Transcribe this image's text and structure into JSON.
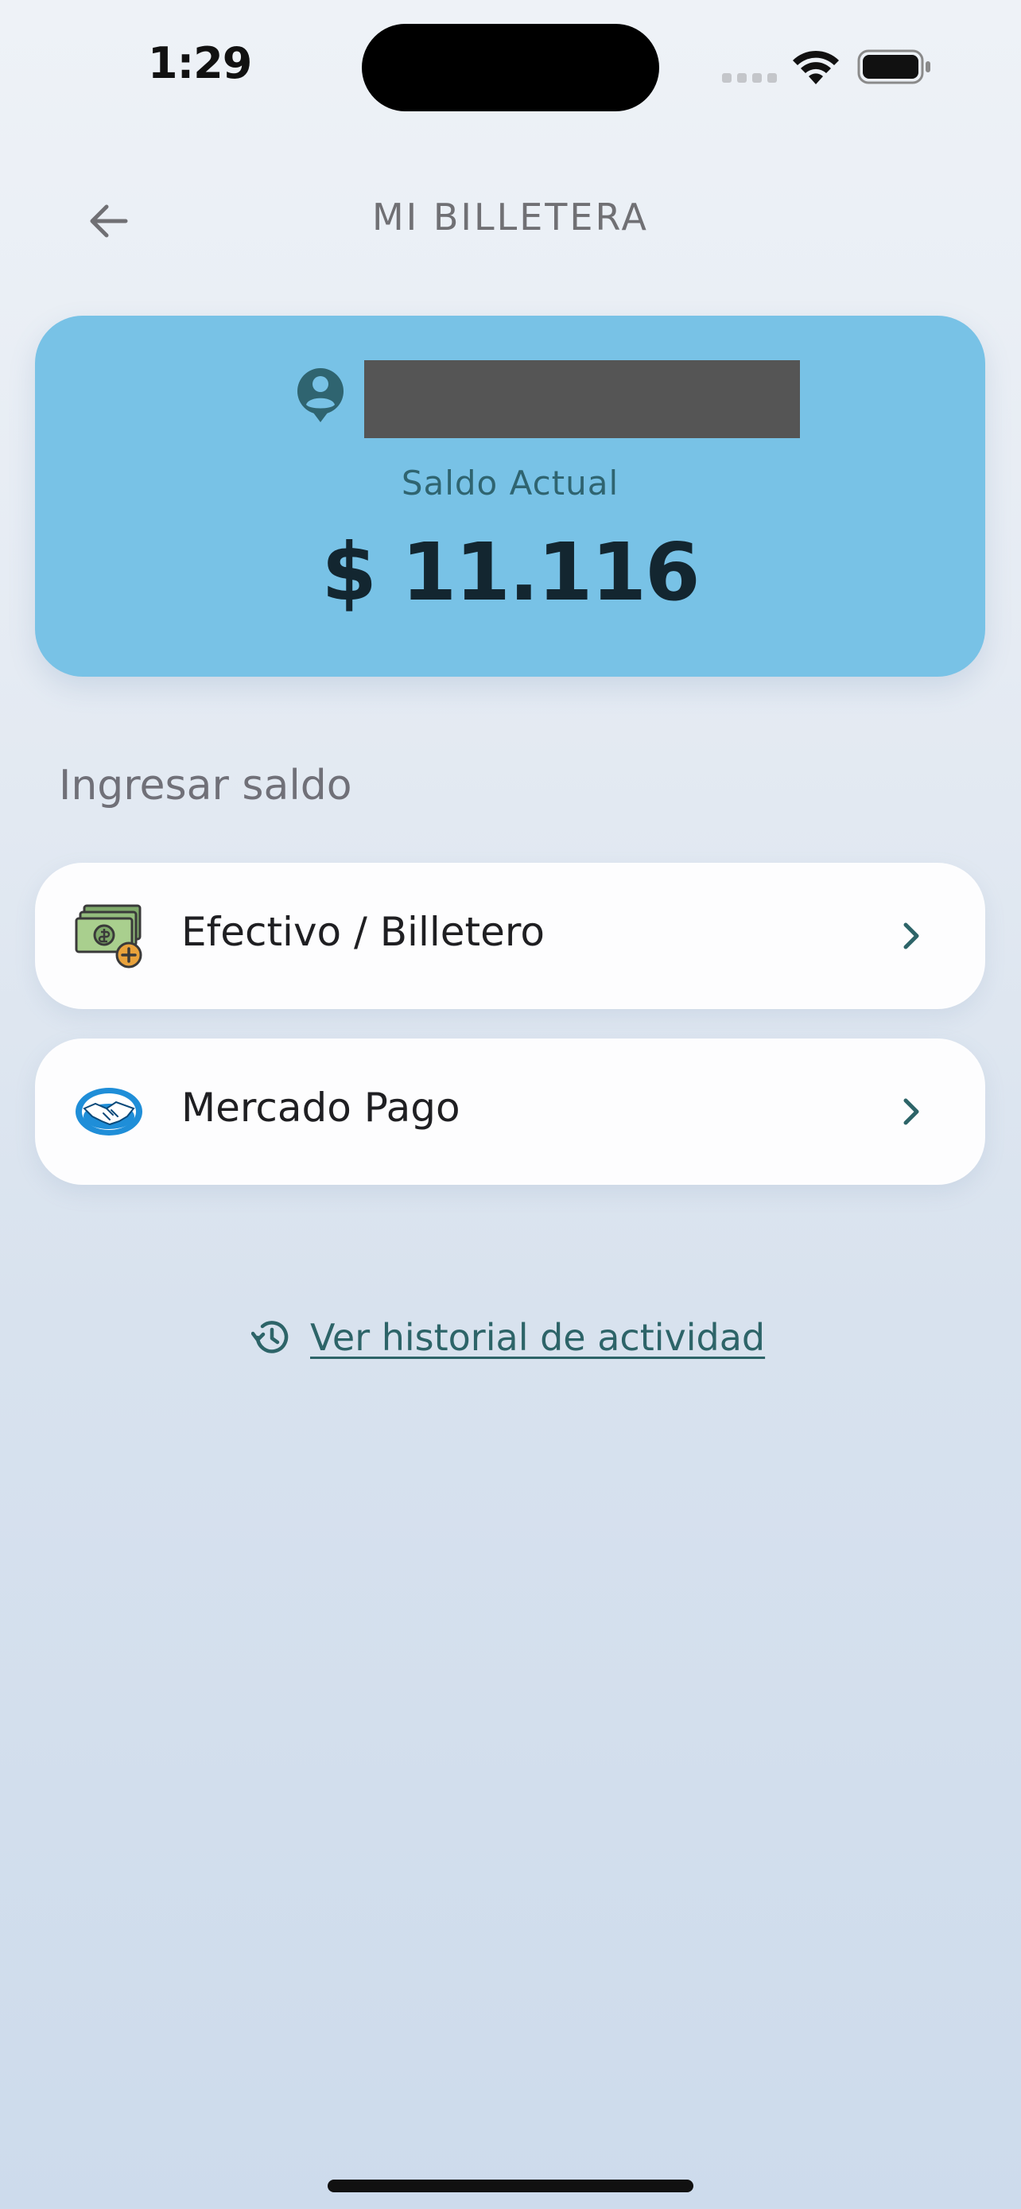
{
  "status_bar": {
    "time": "1:29"
  },
  "header": {
    "title": "MI BILLETERA",
    "back_icon": "arrow-left-icon"
  },
  "balance_card": {
    "label": "Saldo Actual",
    "amount": "$ 11.116",
    "background_color": "#78c2e6",
    "user_icon": "user-location-icon"
  },
  "topup": {
    "section_title": "Ingresar saldo",
    "options": [
      {
        "label": "Efectivo / Billetero",
        "icon": "cash-bills-icon"
      },
      {
        "label": "Mercado Pago",
        "icon": "mercado-pago-handshake-icon"
      }
    ]
  },
  "history": {
    "link_text": "Ver historial de actividad",
    "icon": "history-icon",
    "color": "#2d6468"
  }
}
